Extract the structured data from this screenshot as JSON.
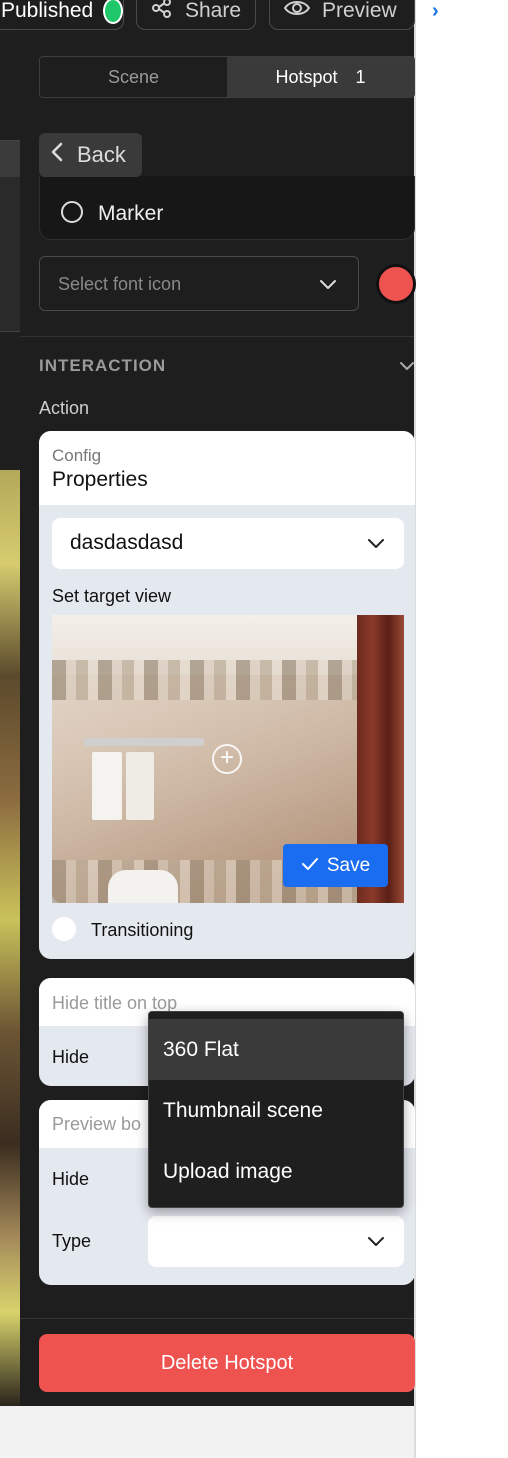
{
  "topbar": {
    "published_label": "Published",
    "share_label": "Share",
    "preview_label": "Preview"
  },
  "tabs": [
    {
      "label": "Scene",
      "active": false
    },
    {
      "label": "Hotspot",
      "count": "1",
      "active": true
    }
  ],
  "hotspot": {
    "back_label": "Back",
    "marker_label": "Marker",
    "font_icon_placeholder": "Select font icon",
    "marker_color": "#ef5350"
  },
  "interaction": {
    "section_title": "INTERACTION",
    "action_label": "Action",
    "config": {
      "subtitle": "Config",
      "title": "Properties",
      "scene_value": "dasdasdasd",
      "target_view_label": "Set target view",
      "save_label": "Save",
      "transitioning_label": "Transitioning"
    },
    "hide_title": {
      "label": "Hide title on top",
      "hide_label": "Hide"
    },
    "preview_box": {
      "label": "Preview bo",
      "hide_label": "Hide",
      "type_label": "Type",
      "type_value": "",
      "type_options": [
        "360 Flat",
        "Thumbnail scene",
        "Upload image"
      ],
      "highlighted_option": "360 Flat"
    }
  },
  "delete_label": "Delete Hotspot",
  "colors": {
    "accent_blue": "#1a6cf0",
    "danger": "#ef5350",
    "published_green": "#1ec76a",
    "panel_bg": "#1e1e1e"
  }
}
